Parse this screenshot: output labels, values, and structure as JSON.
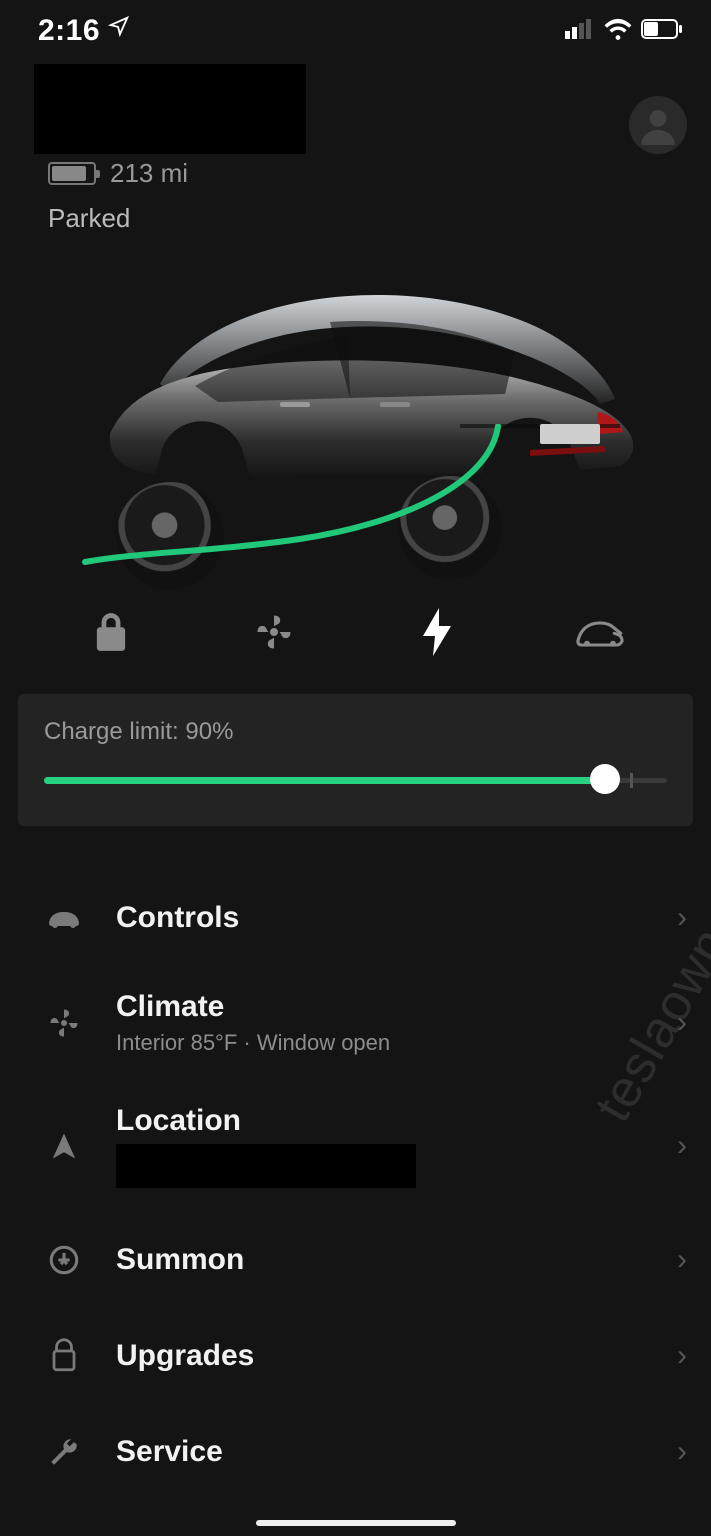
{
  "status": {
    "time": "2:16",
    "battery_pct": 42
  },
  "vehicle": {
    "range": "213 mi",
    "state": "Parked",
    "battery_fill_pct": 78
  },
  "quick": {
    "items": [
      "lock",
      "fan",
      "charge",
      "frunk"
    ],
    "active_index": 2
  },
  "charge": {
    "label": "Charge limit: 90%",
    "value_pct": 90,
    "stop_at_pct": 94
  },
  "menu": [
    {
      "key": "controls",
      "title": "Controls",
      "sub": null,
      "redact_sub": false
    },
    {
      "key": "climate",
      "title": "Climate",
      "sub": "Interior 85°F · Window open",
      "redact_sub": false
    },
    {
      "key": "location",
      "title": "Location",
      "sub": null,
      "redact_sub": true
    },
    {
      "key": "summon",
      "title": "Summon",
      "sub": null,
      "redact_sub": false
    },
    {
      "key": "upgrades",
      "title": "Upgrades",
      "sub": null,
      "redact_sub": false
    },
    {
      "key": "service",
      "title": "Service",
      "sub": null,
      "redact_sub": false
    }
  ],
  "watermark": "teslaownersonline.com"
}
